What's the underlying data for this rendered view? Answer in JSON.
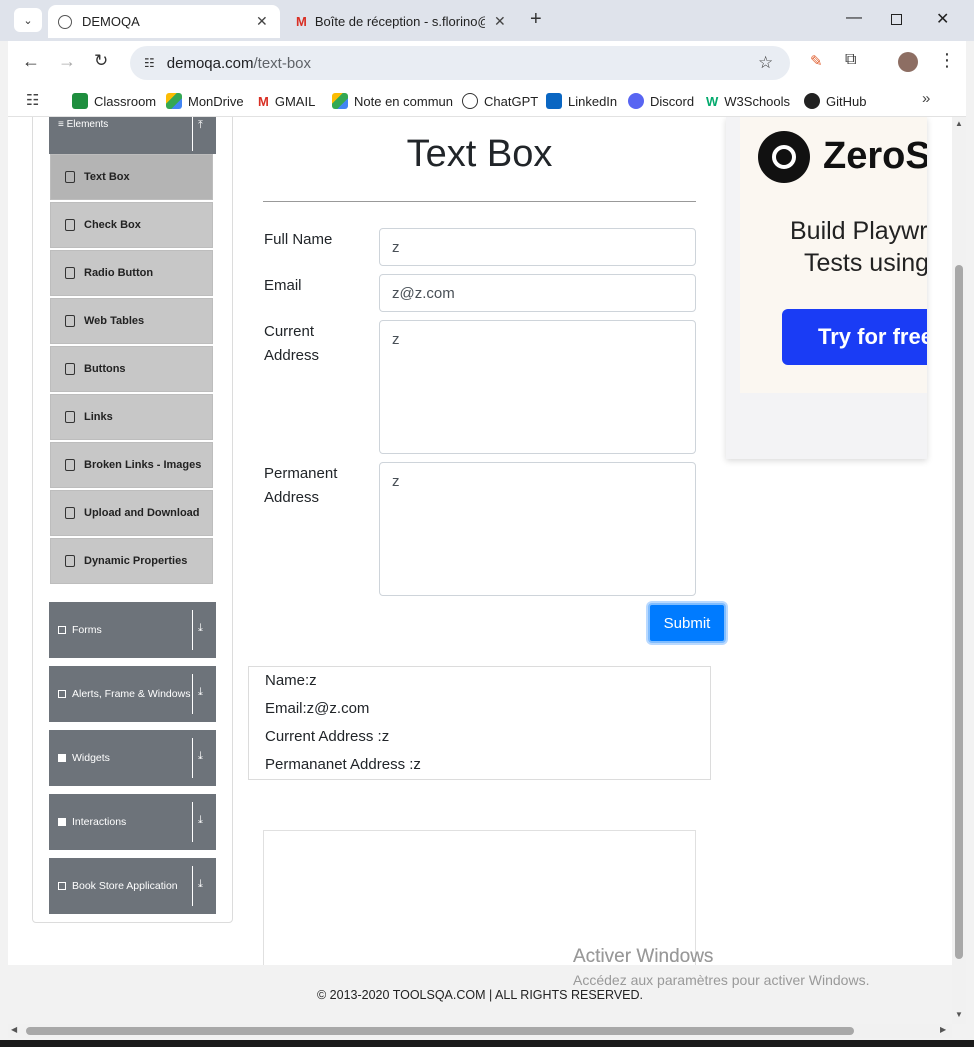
{
  "tabs": [
    {
      "title": "DEMOQA",
      "active": true
    },
    {
      "title": "Boîte de réception - s.florino@",
      "active": false
    }
  ],
  "address": {
    "host": "demoqa.com",
    "path": "/text-box"
  },
  "bookmarks": [
    "Classroom",
    "MonDrive",
    "GMAIL",
    "Note en commun",
    "ChatGPT",
    "LinkedIn",
    "Discord",
    "W3Schools",
    "GitHub"
  ],
  "sidebar": {
    "section": "Elements",
    "items": [
      "Text Box",
      "Check Box",
      "Radio Button",
      "Web Tables",
      "Buttons",
      "Links",
      "Broken Links - Images",
      "Upload and Download",
      "Dynamic Properties"
    ],
    "groups": [
      "Forms",
      "Alerts, Frame & Windows",
      "Widgets",
      "Interactions",
      "Book Store Application"
    ]
  },
  "main": {
    "title": "Text Box",
    "form": {
      "full_name_label": "Full Name",
      "full_name_value": "z",
      "email_label": "Email",
      "email_value": "z@z.com",
      "current_address_label_1": "Current",
      "current_address_label_2": "Address",
      "current_address_value": "z",
      "permanent_address_label_1": "Permanent",
      "permanent_address_label_2": "Address",
      "permanent_address_value": "z",
      "submit_label": "Submit"
    },
    "output": {
      "name": "Name:z",
      "email": "Email:z@z.com",
      "current_address": "Current Address :z",
      "permanent_address": "Permananet Address :z"
    }
  },
  "ad": {
    "brand": "ZeroSt",
    "line1": "Build Playwri",
    "line2": "Tests using",
    "cta": "Try for free"
  },
  "footer": "© 2013-2020 TOOLSQA.COM | ALL RIGHTS RESERVED.",
  "watermark": {
    "title": "Activer Windows",
    "subtitle": "Accédez aux paramètres pour activer Windows."
  },
  "colors": {
    "accent": "#007bff",
    "sidebar_group": "#6d737a",
    "ad_cta": "#1a3cf5"
  }
}
